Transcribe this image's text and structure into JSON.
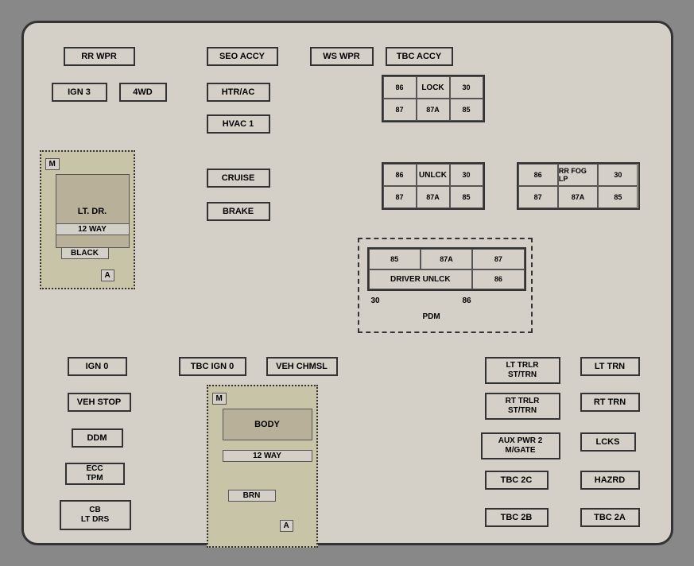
{
  "labels": {
    "rr_wpr": "RR WPR",
    "seo_accy": "SEO ACCY",
    "ws_wpr": "WS WPR",
    "tbc_accy": "TBC ACCY",
    "ign3": "IGN 3",
    "4wd": "4WD",
    "htr_ac": "HTR/AC",
    "hvac1": "HVAC 1",
    "cruise": "CRUISE",
    "brake": "BRAKE",
    "lt_dr": "LT. DR.",
    "m_label": "M",
    "12way": "12 WAY",
    "black": "BLACK",
    "a_label": "A",
    "lock": "LOCK",
    "unlck": "UNLCK",
    "driver_unlck": "DRIVER UNLCK",
    "rr_fog_lp": "RR FOG LP",
    "pdm": "PDM",
    "ign0": "IGN 0",
    "tbc_ign0": "TBC IGN 0",
    "veh_chmsl": "VEH CHMSL",
    "veh_stop": "VEH STOP",
    "ddm": "DDM",
    "ecc_tpm": "ECC\nTPM",
    "cb_lt_drs": "CB\nLT DRS",
    "body": "BODY",
    "body_12way": "12 WAY",
    "brn": "BRN",
    "body_a": "A",
    "body_m": "M",
    "lt_trlr_st_trn": "LT TRLR\nST/TRN",
    "lt_trn": "LT TRN",
    "rt_trlr_st_trn": "RT TRLR\nST/TRN",
    "rt_trn": "RT TRN",
    "aux_pwr2": "AUX PWR 2\nM/GATE",
    "lcks": "LCKS",
    "tbc_2c": "TBC 2C",
    "hazrd": "HAZRD",
    "tbc_2b": "TBC 2B",
    "tbc_2a": "TBC 2A",
    "r86": "86",
    "r87": "87",
    "r87a": "87A",
    "r85": "85",
    "r30": "30",
    "r30b": "30",
    "r86b": "86"
  }
}
